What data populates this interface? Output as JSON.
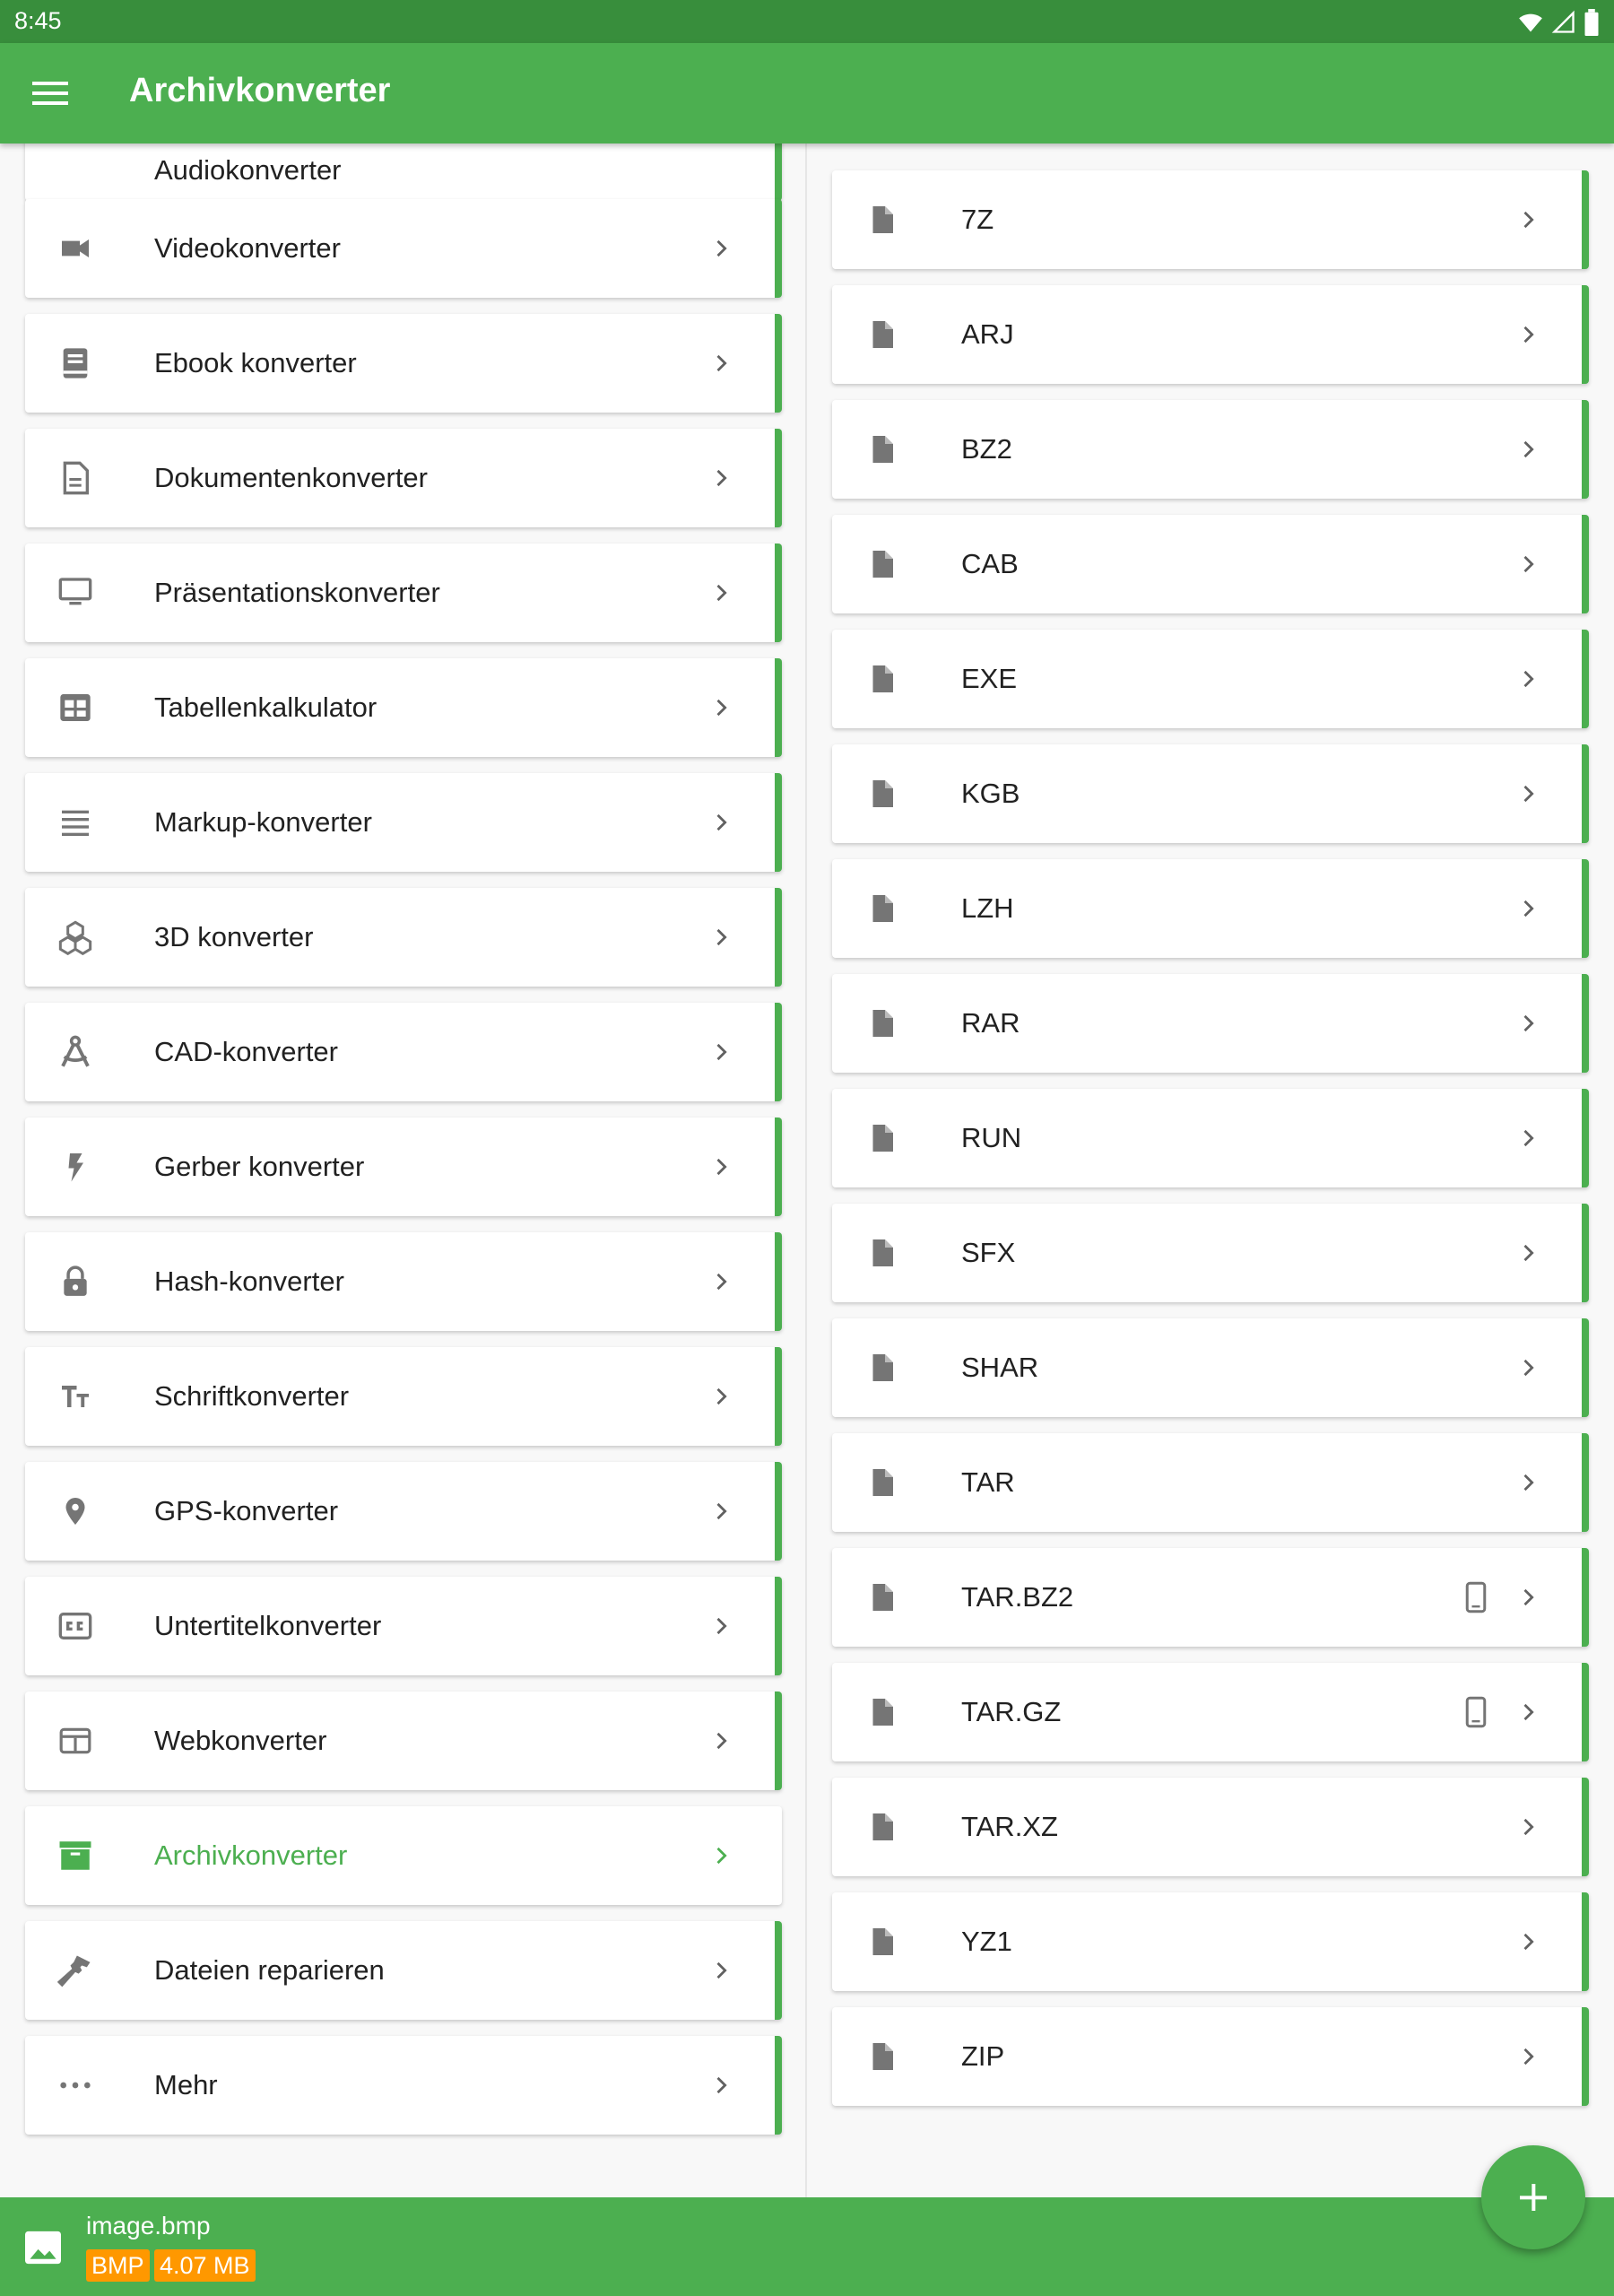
{
  "status_bar": {
    "time": "8:45"
  },
  "app_bar": {
    "title": "Archivkonverter"
  },
  "left_list": {
    "partial_label": "Audiokonverter",
    "items": [
      {
        "label": "Videokonverter",
        "icon": "video-camera-icon"
      },
      {
        "label": "Ebook konverter",
        "icon": "book-icon"
      },
      {
        "label": "Dokumentenkonverter",
        "icon": "document-icon"
      },
      {
        "label": "Präsentationskonverter",
        "icon": "monitor-icon"
      },
      {
        "label": "Tabellenkalkulator",
        "icon": "table-icon"
      },
      {
        "label": "Markup-konverter",
        "icon": "lines-icon"
      },
      {
        "label": "3D konverter",
        "icon": "cubes-icon"
      },
      {
        "label": "CAD-konverter",
        "icon": "compass-icon"
      },
      {
        "label": "Gerber konverter",
        "icon": "lightning-icon"
      },
      {
        "label": "Hash-konverter",
        "icon": "lock-icon"
      },
      {
        "label": "Schriftkonverter",
        "icon": "font-size-icon"
      },
      {
        "label": "GPS-konverter",
        "icon": "location-pin-icon"
      },
      {
        "label": "Untertitelkonverter",
        "icon": "closed-caption-icon"
      },
      {
        "label": "Webkonverter",
        "icon": "web-window-icon"
      },
      {
        "label": "Archivkonverter",
        "icon": "archive-box-icon",
        "active": true
      },
      {
        "label": "Dateien reparieren",
        "icon": "hammer-icon"
      },
      {
        "label": "Mehr",
        "icon": "more-dots-icon"
      }
    ]
  },
  "right_list": {
    "items": [
      {
        "label": "7Z"
      },
      {
        "label": "ARJ"
      },
      {
        "label": "BZ2"
      },
      {
        "label": "CAB"
      },
      {
        "label": "EXE"
      },
      {
        "label": "KGB"
      },
      {
        "label": "LZH"
      },
      {
        "label": "RAR"
      },
      {
        "label": "RUN"
      },
      {
        "label": "SFX"
      },
      {
        "label": "SHAR"
      },
      {
        "label": "TAR"
      },
      {
        "label": "TAR.BZ2",
        "device": true
      },
      {
        "label": "TAR.GZ",
        "device": true
      },
      {
        "label": "TAR.XZ"
      },
      {
        "label": "YZ1"
      },
      {
        "label": "ZIP"
      }
    ]
  },
  "bottom_bar": {
    "file_name": "image.bmp",
    "format_badge": "BMP",
    "size_badge": "4.07 MB"
  },
  "fab": {
    "icon": "plus-icon"
  },
  "colors": {
    "accent": "#4caf50",
    "status_bar": "#388e3c",
    "badge": "#ff9800",
    "icon_gray": "#757575"
  }
}
